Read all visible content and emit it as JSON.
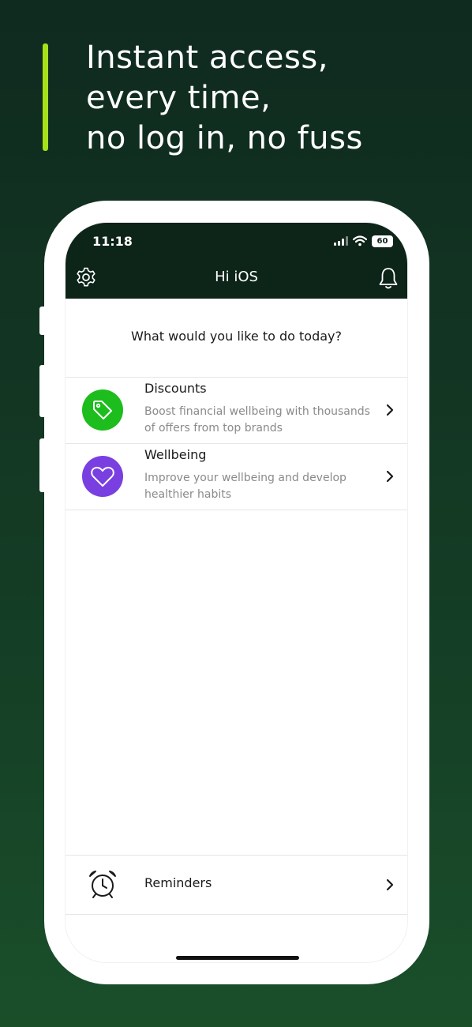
{
  "headline": {
    "lines": [
      "Instant access,",
      "every time,",
      "no log in, no fuss"
    ],
    "accent_color": "#a6e01b"
  },
  "status_bar": {
    "time": "11:18",
    "battery": "60",
    "icons": [
      "signal-icon",
      "wifi-icon",
      "battery-icon"
    ]
  },
  "nav": {
    "title": "Hi iOS",
    "left_icon": "gear-icon",
    "right_icon": "bell-icon"
  },
  "main": {
    "prompt": "What would you like to do today?",
    "items": [
      {
        "title": "Discounts",
        "description": "Boost financial wellbeing with thousands of offers from top brands",
        "icon": "tag-icon",
        "icon_color": "#1cbd1c"
      },
      {
        "title": "Wellbeing",
        "description": "Improve your wellbeing and develop healthier habits",
        "icon": "heart-icon",
        "icon_color": "#7a3fe0"
      }
    ]
  },
  "footer": {
    "reminders_label": "Reminders",
    "icon": "alarm-clock-icon"
  }
}
